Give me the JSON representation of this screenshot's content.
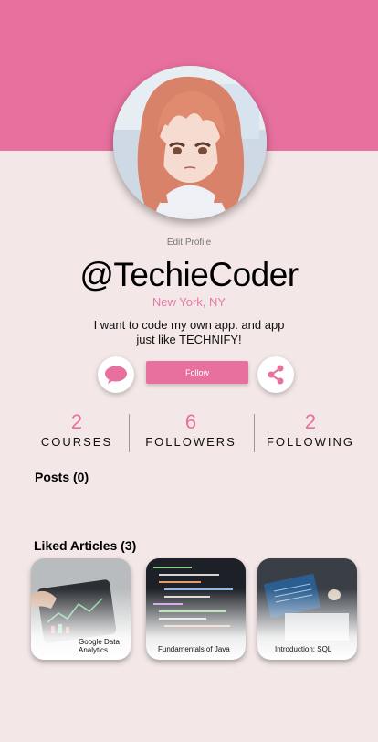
{
  "profile": {
    "edit_label": "Edit Profile",
    "username": "@TechieCoder",
    "location": "New York, NY",
    "bio": "I want to code my own app. and app just like TECHNIFY!",
    "follow_label": "Follow"
  },
  "stats": [
    {
      "value": "2",
      "label": "COURSES"
    },
    {
      "value": "6",
      "label": "FOLLOWERS"
    },
    {
      "value": "2",
      "label": "FOLLOWING"
    }
  ],
  "posts": {
    "title": "Posts (0)"
  },
  "liked": {
    "title": "Liked Articles (3)",
    "articles": [
      {
        "title": "Google Data Analytics"
      },
      {
        "title": "Fundamentals of Java"
      },
      {
        "title": "Introduction: SQL"
      }
    ]
  },
  "colors": {
    "accent": "#e8709f",
    "background": "#f3e7e7",
    "location": "#e47aa8"
  },
  "icons": {
    "message": "chat-bubble-icon",
    "share": "share-icon"
  }
}
